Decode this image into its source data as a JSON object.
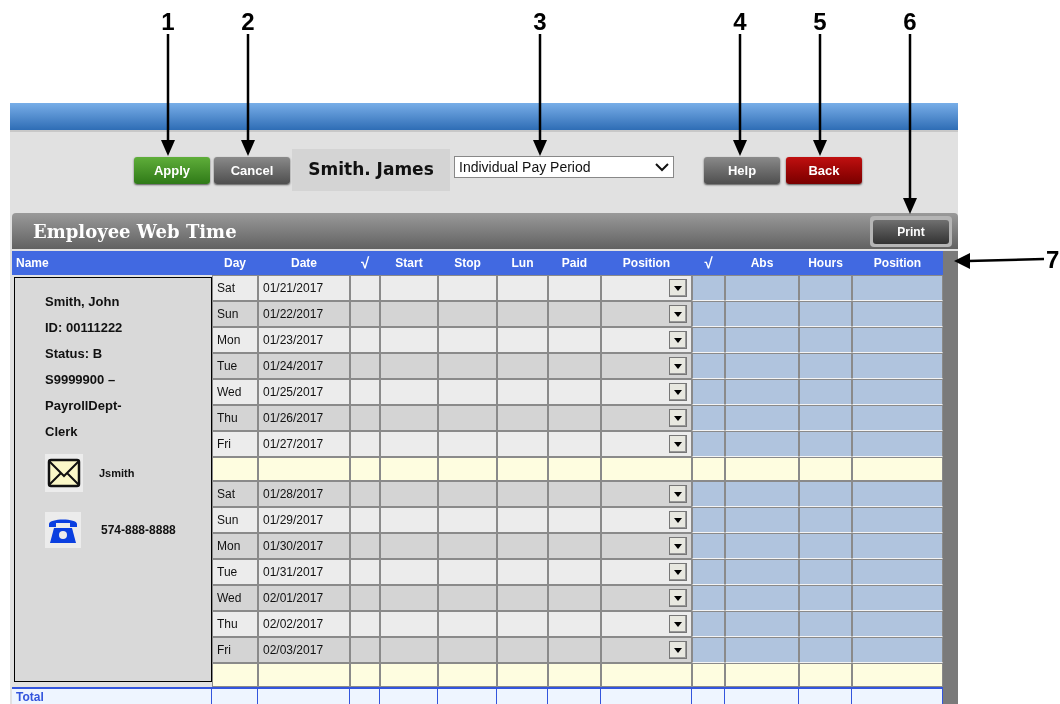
{
  "callouts": [
    {
      "label": "1"
    },
    {
      "label": "2"
    },
    {
      "label": "3"
    },
    {
      "label": "4"
    },
    {
      "label": "5"
    },
    {
      "label": "6"
    },
    {
      "label": "7"
    }
  ],
  "toolbar": {
    "buttons": [
      {
        "label": "Apply",
        "kind": "green"
      },
      {
        "label": "Cancel",
        "kind": "gray"
      }
    ],
    "user_name": "Smith. James",
    "period_select": {
      "value": "Individual Pay Period"
    },
    "right_buttons": [
      {
        "label": "Help",
        "kind": "gray"
      },
      {
        "label": "Back",
        "kind": "red"
      }
    ]
  },
  "panel": {
    "title": "Employee Web Time",
    "print_button": "Print"
  },
  "table": {
    "columns": [
      "Name",
      "Day",
      "Date",
      "√",
      "Start",
      "Stop",
      "Lun",
      "Paid",
      "Position",
      "√",
      "Abs",
      "Hours",
      "Position"
    ],
    "employee": {
      "lines": [
        "Smith, John",
        "ID: 00111222",
        "Status: B",
        "S9999900 –",
        "PayrollDept-",
        "Clerk"
      ],
      "email": "Jsmith",
      "phone": "574-888-8888"
    },
    "rows": [
      {
        "kind": "day",
        "day": "Sat",
        "date": "01/21/2017"
      },
      {
        "kind": "day",
        "day": "Sun",
        "date": "01/22/2017"
      },
      {
        "kind": "day",
        "day": "Mon",
        "date": "01/23/2017"
      },
      {
        "kind": "day",
        "day": "Tue",
        "date": "01/24/2017"
      },
      {
        "kind": "day",
        "day": "Wed",
        "date": "01/25/2017"
      },
      {
        "kind": "day",
        "day": "Thu",
        "date": "01/26/2017"
      },
      {
        "kind": "day",
        "day": "Fri",
        "date": "01/27/2017"
      },
      {
        "kind": "spacer"
      },
      {
        "kind": "day",
        "day": "Sat",
        "date": "01/28/2017"
      },
      {
        "kind": "day",
        "day": "Sun",
        "date": "01/29/2017"
      },
      {
        "kind": "day",
        "day": "Mon",
        "date": "01/30/2017"
      },
      {
        "kind": "day",
        "day": "Tue",
        "date": "01/31/2017"
      },
      {
        "kind": "day",
        "day": "Wed",
        "date": "02/01/2017"
      },
      {
        "kind": "day",
        "day": "Thu",
        "date": "02/02/2017"
      },
      {
        "kind": "day",
        "day": "Fri",
        "date": "02/03/2017"
      },
      {
        "kind": "spacer"
      }
    ],
    "total_label": "Total"
  }
}
